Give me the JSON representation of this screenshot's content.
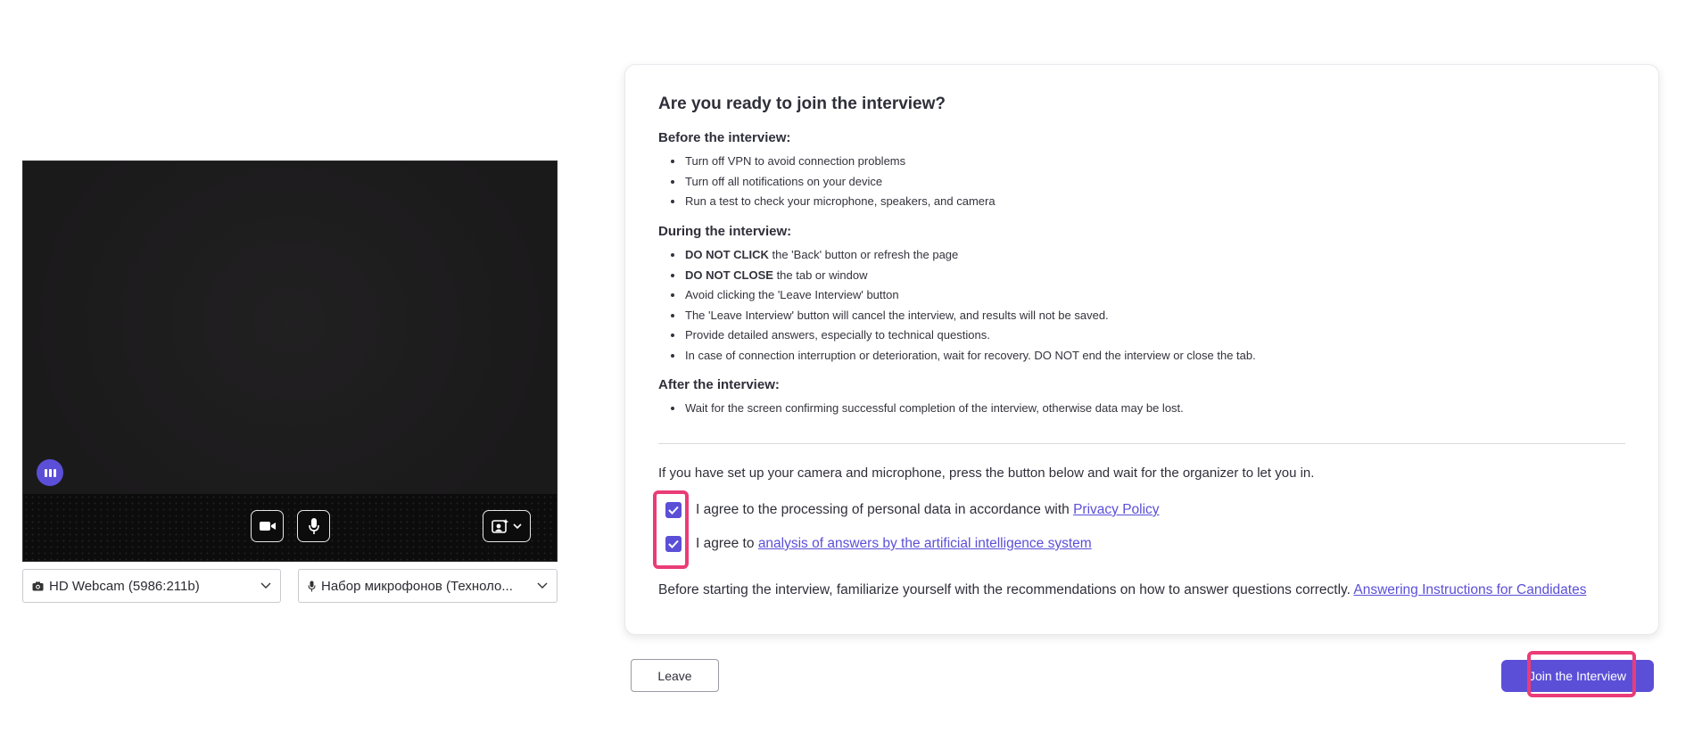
{
  "preview": {
    "camera_icon": "video-camera-icon",
    "mic_icon": "microphone-icon",
    "background_icon": "background-effects-icon",
    "audio_level_icon": "audio-level-icon"
  },
  "devices": {
    "camera": {
      "icon": "camera-icon",
      "value": "HD Webcam (5986:211b)"
    },
    "microphone": {
      "icon": "microphone-icon",
      "value": "Набор микрофонов (Техноло..."
    }
  },
  "card": {
    "title": "Are you ready to join the interview?",
    "before": {
      "title": "Before the interview:",
      "items": [
        "Turn off VPN to avoid connection problems",
        "Turn off all notifications on your device",
        "Run a test to check your microphone, speakers, and camera"
      ]
    },
    "during": {
      "title": "During the interview:",
      "items": [
        {
          "bold": "DO NOT CLICK",
          "text": " the 'Back' button or refresh the page"
        },
        {
          "bold": "DO NOT CLOSE",
          "text": " the tab or window"
        },
        {
          "bold": "",
          "text": "Avoid clicking the 'Leave Interview' button"
        },
        {
          "bold": "",
          "text": "The 'Leave Interview' button will cancel the interview, and results will not be saved."
        },
        {
          "bold": "",
          "text": "Provide detailed answers, especially to technical questions."
        },
        {
          "bold": "",
          "text": "In case of connection interruption or deterioration, wait for recovery. DO NOT end the interview or close the tab."
        }
      ]
    },
    "after": {
      "title": "After the interview:",
      "items": [
        "Wait for the screen confirming successful completion of the interview, otherwise data may be lost."
      ]
    },
    "prompt": "If you have set up your camera and microphone, press the button below and wait for the organizer to let you in.",
    "consent1": {
      "checked": true,
      "text": "I agree to the processing of personal data in accordance with ",
      "link": "Privacy Policy"
    },
    "consent2": {
      "checked": true,
      "text": "I agree to ",
      "link": "analysis of answers by the artificial intelligence system"
    },
    "footnote": {
      "text": "Before starting the interview, familiarize yourself with the recommendations on how to answer questions correctly. ",
      "link": "Answering Instructions for Candidates"
    }
  },
  "actions": {
    "leave": "Leave",
    "join": "Join the Interview"
  },
  "colors": {
    "accent": "#5b4fd8",
    "highlight": "#ea3c78"
  }
}
